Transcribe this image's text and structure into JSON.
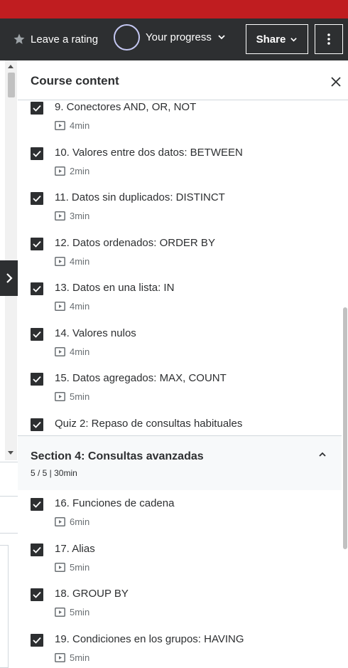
{
  "header": {
    "rating_label": "Leave a rating",
    "progress_label": "Your progress",
    "share_label": "Share"
  },
  "panel": {
    "title": "Course content"
  },
  "items_top": [
    {
      "title": "9. Conectores AND, OR, NOT",
      "duration": "4min",
      "checked": true
    },
    {
      "title": "10. Valores entre dos datos: BETWEEN",
      "duration": "2min",
      "checked": true
    },
    {
      "title": "11. Datos sin duplicados: DISTINCT",
      "duration": "3min",
      "checked": true
    },
    {
      "title": "12. Datos ordenados: ORDER BY",
      "duration": "4min",
      "checked": true
    },
    {
      "title": "13. Datos en una lista: IN",
      "duration": "4min",
      "checked": true
    },
    {
      "title": "14. Valores nulos",
      "duration": "4min",
      "checked": true
    },
    {
      "title": "15. Datos agregados: MAX, COUNT",
      "duration": "5min",
      "checked": true
    },
    {
      "title": "Quiz 2: Repaso de consultas habituales",
      "duration": "",
      "checked": true
    }
  ],
  "section4": {
    "title": "Section 4: Consultas avanzadas",
    "meta": "5 / 5 | 30min"
  },
  "items_bottom": [
    {
      "title": "16. Funciones de cadena",
      "duration": "6min",
      "checked": true
    },
    {
      "title": "17. Alias",
      "duration": "5min",
      "checked": true
    },
    {
      "title": "18. GROUP BY",
      "duration": "5min",
      "checked": true
    },
    {
      "title": "19. Condiciones en los grupos: HAVING",
      "duration": "5min",
      "checked": true
    }
  ],
  "colors": {
    "header_bg": "#2d2f31",
    "top_strip": "#c01d20",
    "progress_ring": "#c4c7f2",
    "section_bg": "#f7f9fa"
  }
}
